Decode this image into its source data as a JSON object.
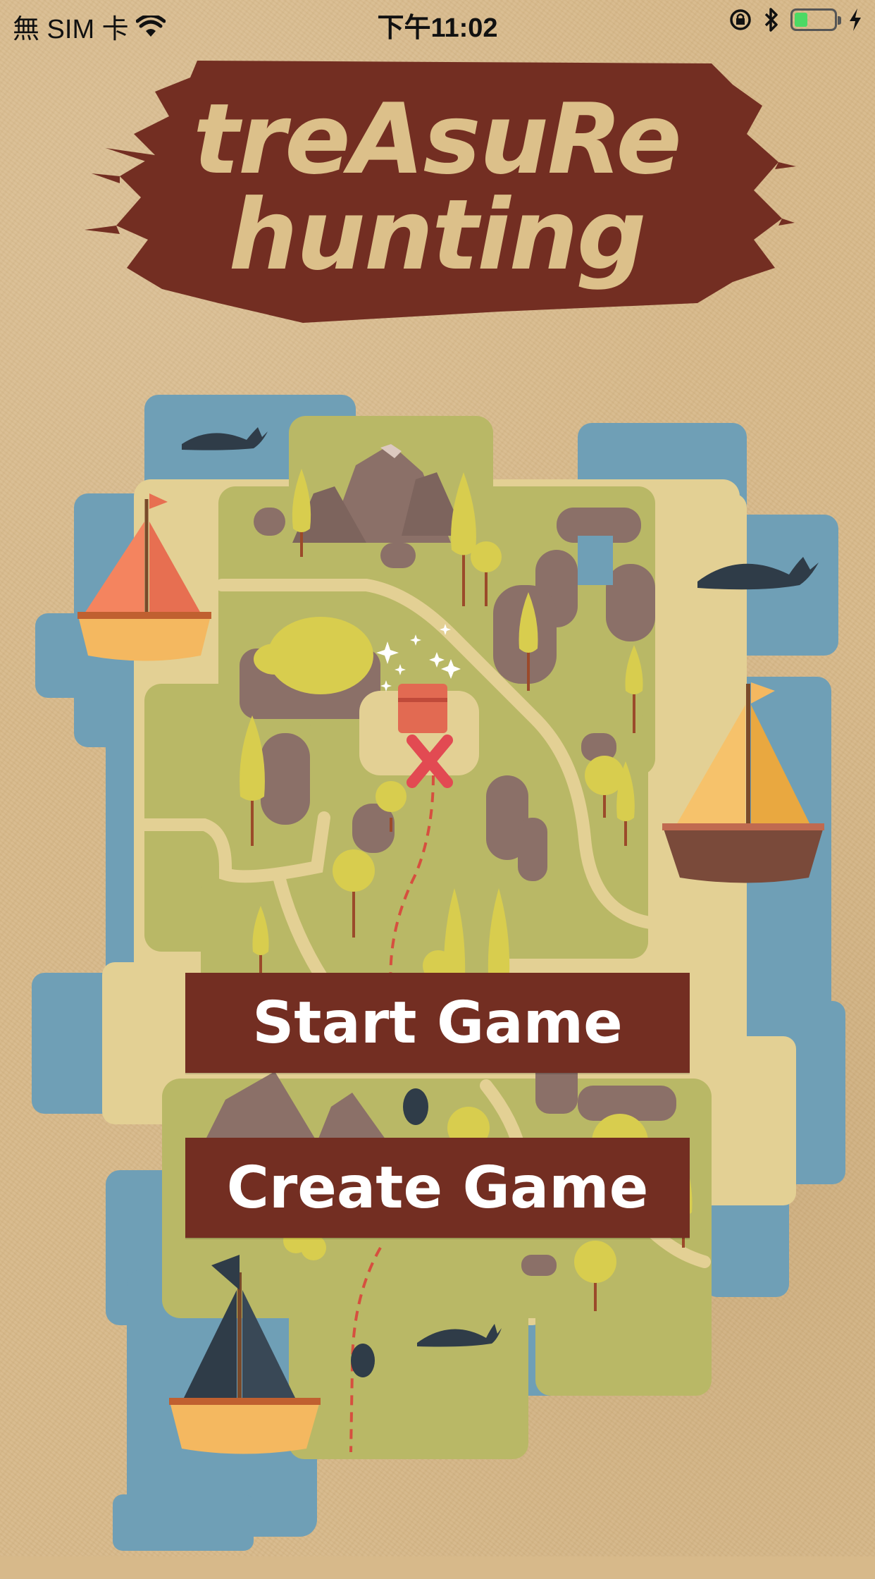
{
  "status_bar": {
    "carrier": "無 SIM 卡",
    "time": "下午11:02"
  },
  "title": {
    "line1": "treAsuRe",
    "line2": "hunting"
  },
  "buttons": {
    "start": "Start Game",
    "create": "Create Game"
  },
  "icons": [
    "wifi-icon",
    "orientation-lock-icon",
    "bluetooth-icon",
    "battery-icon",
    "charging-icon"
  ],
  "colors": {
    "background": "#d7b98a",
    "accent": "#732e22",
    "title_text": "#dcc08a",
    "water": "#6f9fb6",
    "land": "#b9b866",
    "sand": "#e3d094"
  }
}
